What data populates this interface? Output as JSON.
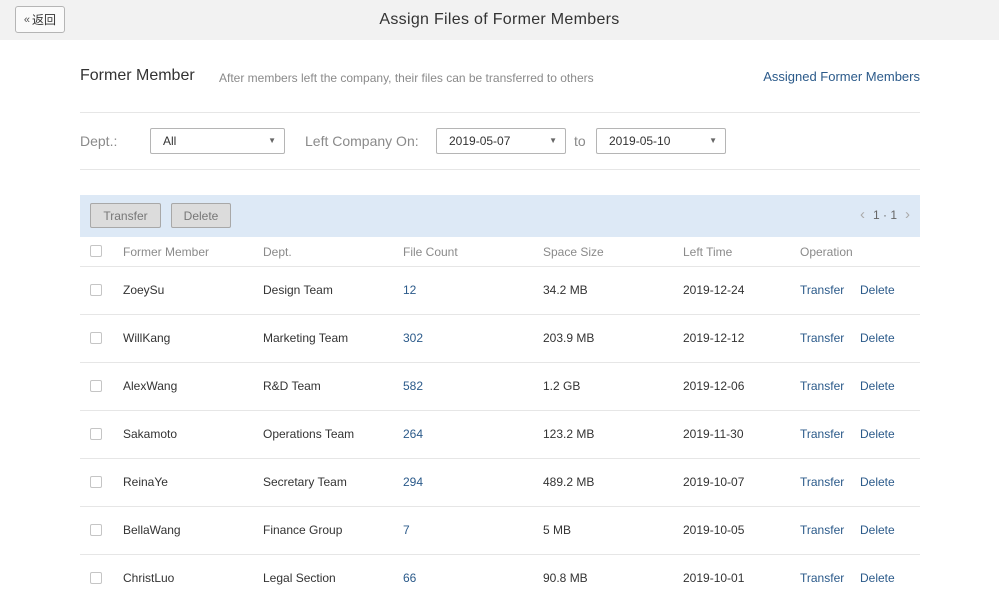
{
  "header": {
    "back_label": "返回",
    "title": "Assign Files of Former Members"
  },
  "section": {
    "title": "Former Member",
    "description": "After members left the company, their files can be transferred to others",
    "assigned_link": "Assigned Former Members"
  },
  "filters": {
    "dept_label": "Dept.:",
    "dept_value": "All",
    "left_label": "Left Company On:",
    "date_from": "2019-05-07",
    "to_label": "to",
    "date_to": "2019-05-10"
  },
  "toolbar": {
    "transfer_label": "Transfer",
    "delete_label": "Delete",
    "page_info": "1 · 1"
  },
  "table": {
    "columns": [
      "Former Member",
      "Dept.",
      "File Count",
      "Space Size",
      "Left Time",
      "Operation"
    ],
    "rows": [
      {
        "member": "ZoeySu",
        "dept": "Design Team",
        "count": "12",
        "size": "34.2 MB",
        "left": "2019-12-24",
        "op1": "Transfer",
        "op2": "Delete"
      },
      {
        "member": "WillKang",
        "dept": "Marketing Team",
        "count": "302",
        "size": "203.9 MB",
        "left": "2019-12-12",
        "op1": "Transfer",
        "op2": "Delete"
      },
      {
        "member": "AlexWang",
        "dept": "R&D Team",
        "count": "582",
        "size": "1.2 GB",
        "left": "2019-12-06",
        "op1": "Transfer",
        "op2": "Delete"
      },
      {
        "member": "Sakamoto",
        "dept": "Operations Team",
        "count": "264",
        "size": "123.2 MB",
        "left": "2019-11-30",
        "op1": "Transfer",
        "op2": "Delete"
      },
      {
        "member": "ReinaYe",
        "dept": "Secretary Team",
        "count": "294",
        "size": "489.2 MB",
        "left": "2019-10-07",
        "op1": "Transfer",
        "op2": "Delete"
      },
      {
        "member": "BellaWang",
        "dept": "Finance Group",
        "count": "7",
        "size": "5 MB",
        "left": "2019-10-05",
        "op1": "Transfer",
        "op2": "Delete"
      },
      {
        "member": "ChristLuo",
        "dept": "Legal Section",
        "count": "66",
        "size": "90.8 MB",
        "left": "2019-10-01",
        "op1": "Transfer",
        "op2": "Delete"
      }
    ]
  },
  "colors": {
    "link": "#2b5a8a",
    "toolbar_bg": "#dde9f6",
    "topbar_bg": "#f2f2f2"
  }
}
